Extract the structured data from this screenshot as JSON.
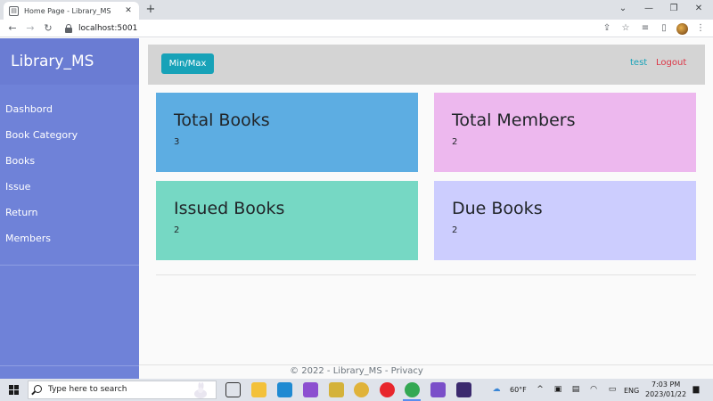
{
  "browser": {
    "tab_title": "Home Page - Library_MS",
    "tab_close": "✕",
    "new_tab": "+",
    "url": "localhost:5001"
  },
  "sidebar": {
    "brand": "Library_MS",
    "items": [
      {
        "label": "Dashbord"
      },
      {
        "label": "Book Category"
      },
      {
        "label": "Books"
      },
      {
        "label": "Issue"
      },
      {
        "label": "Return"
      },
      {
        "label": "Members"
      }
    ]
  },
  "topbar": {
    "minmax_label": "Min/Max",
    "user_label": "test",
    "logout_label": "Logout"
  },
  "cards": [
    {
      "title": "Total Books",
      "value": "3",
      "color": "#5dade2"
    },
    {
      "title": "Total Members",
      "value": "2",
      "color": "#edb8ee"
    },
    {
      "title": "Issued Books",
      "value": "2",
      "color": "#76d8c4"
    },
    {
      "title": "Due Books",
      "value": "2",
      "color": "#cccdfe"
    }
  ],
  "footer": {
    "copyright": "© 2022 - Library_MS - ",
    "privacy_label": "Privacy"
  },
  "taskbar": {
    "search_placeholder": "Type here to search",
    "weather": "60°F",
    "language": "ENG",
    "time": "7:03 PM",
    "date": "2023/01/22"
  },
  "colors": {
    "sidebar": "#6f82d8",
    "accent": "#17a2b8",
    "logout": "#dc3545"
  }
}
